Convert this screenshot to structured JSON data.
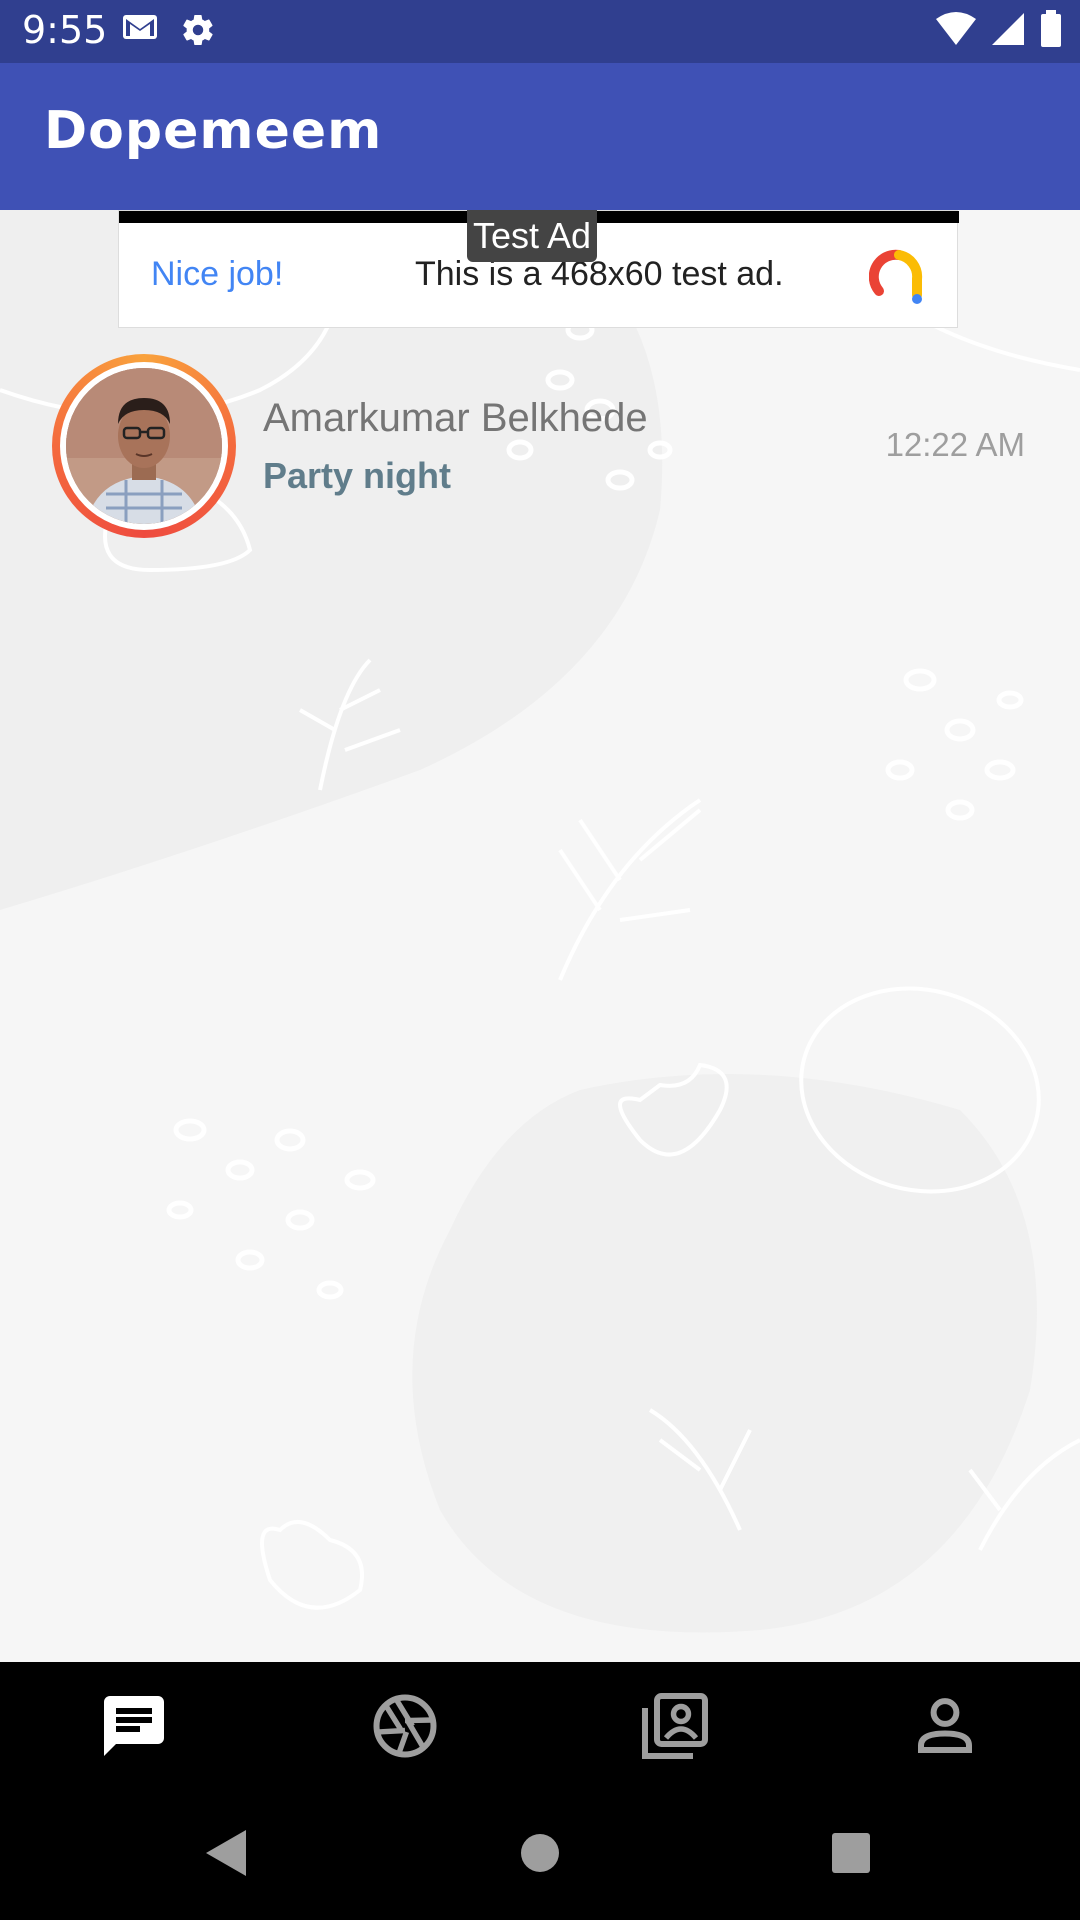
{
  "status_bar": {
    "time": "9:55",
    "left_icons": [
      "gmail-icon",
      "settings-icon"
    ],
    "right_icons": [
      "wifi-icon",
      "signal-icon",
      "battery-icon"
    ]
  },
  "app_bar": {
    "title": "Dopemeem"
  },
  "ad": {
    "badge": "Test Ad",
    "left_text": "Nice job!",
    "body_text": "This is a 468x60 test ad.",
    "logo_icon": "adchoices-logo-icon"
  },
  "chats": [
    {
      "name": "Amarkumar Belkhede",
      "last_message": "Party night",
      "time": "12:22 AM"
    }
  ],
  "bottom_nav": {
    "items": [
      {
        "icon": "chat-icon",
        "active": true
      },
      {
        "icon": "camera-shutter-icon",
        "active": false
      },
      {
        "icon": "photo-library-icon",
        "active": false
      },
      {
        "icon": "person-icon",
        "active": false
      }
    ]
  },
  "system_nav": {
    "buttons": [
      "back-icon",
      "home-icon",
      "recents-icon"
    ]
  },
  "colors": {
    "status_bar": "#303f8f",
    "app_bar": "#3f51b5",
    "accent_message": "#607d8b",
    "ring_start": "#f9a23d",
    "ring_end": "#ee4b3f"
  }
}
